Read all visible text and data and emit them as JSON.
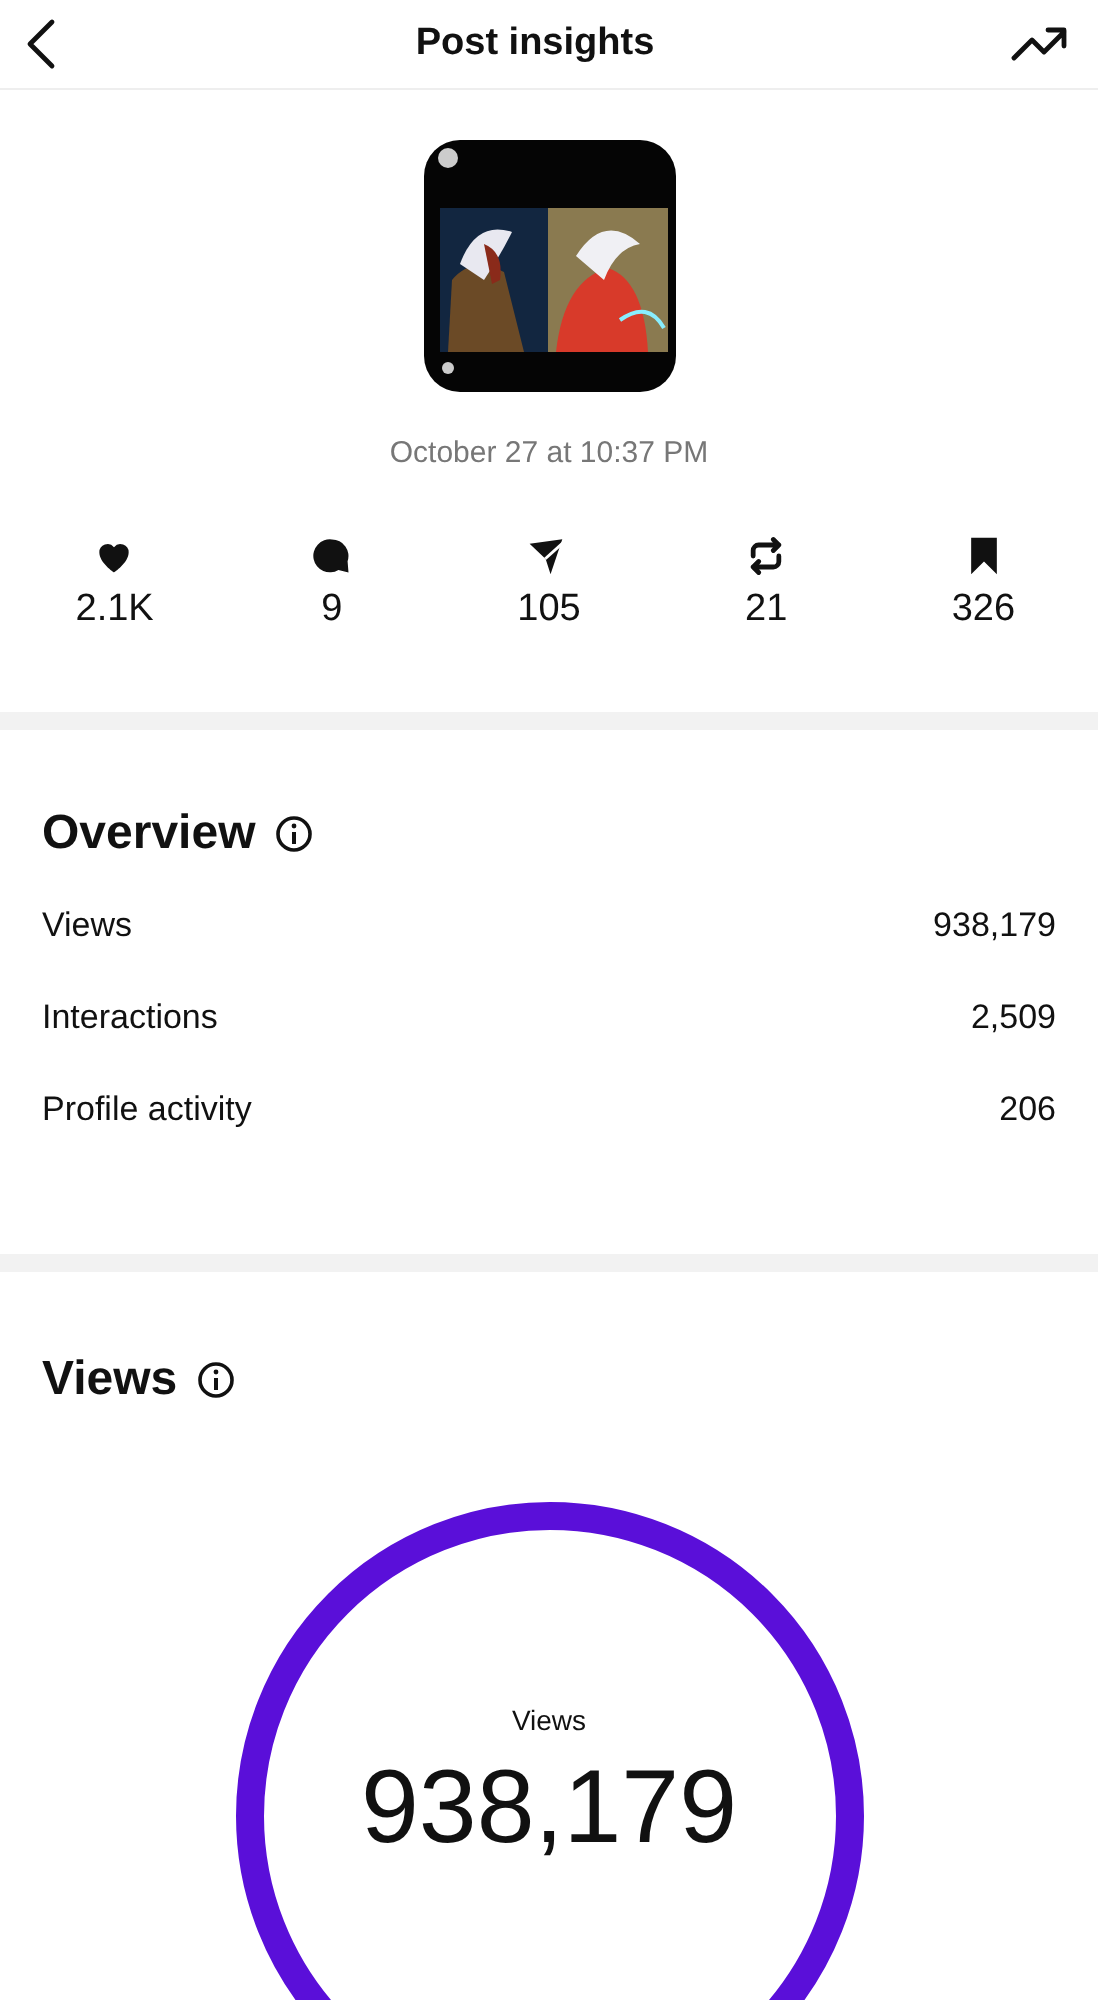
{
  "header": {
    "title": "Post insights"
  },
  "post": {
    "date": "October 27 at 10:37 PM"
  },
  "stats": [
    {
      "kind": "heart",
      "value": "2.1K"
    },
    {
      "kind": "comment",
      "value": "9"
    },
    {
      "kind": "share",
      "value": "105"
    },
    {
      "kind": "repost",
      "value": "21"
    },
    {
      "kind": "bookmark",
      "value": "326"
    }
  ],
  "overview": {
    "title": "Overview",
    "rows": [
      {
        "label": "Views",
        "value": "938,179"
      },
      {
        "label": "Interactions",
        "value": "2,509"
      },
      {
        "label": "Profile activity",
        "value": "206"
      }
    ]
  },
  "views": {
    "title": "Views",
    "ring_label": "Views",
    "ring_value": "938,179"
  }
}
